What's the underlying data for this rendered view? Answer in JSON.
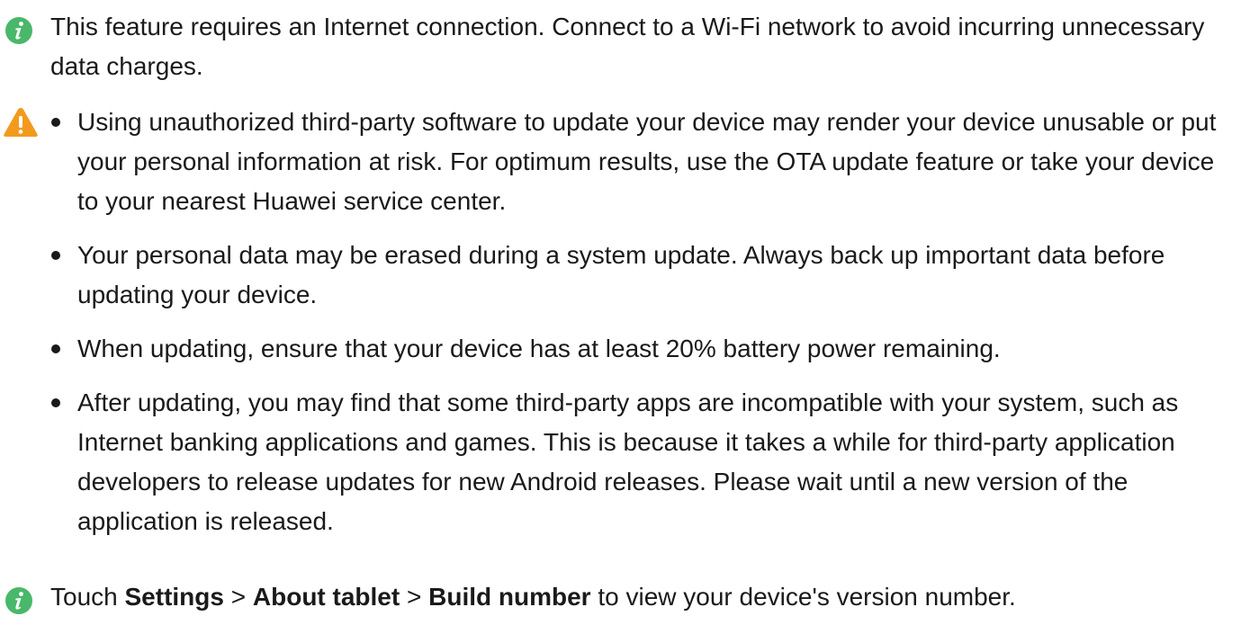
{
  "notes": {
    "internet_note": "This feature requires an Internet connection. Connect to a Wi-Fi network to avoid incurring unnecessary data charges.",
    "warnings": [
      "Using unauthorized third-party software to update your device may render your device unusable or put your personal information at risk. For optimum results, use the OTA update feature or take your device to your nearest Huawei service center.",
      "Your personal data may be erased during a system update. Always back up important data before updating your device.",
      "When updating, ensure that your device has at least 20% battery power remaining.",
      "After updating, you may find that some third-party apps are incompatible with your system, such as Internet banking applications and games. This is because it takes a while for third-party application developers to release updates for new Android releases. Please wait until a new version of the application is released."
    ],
    "version_note": {
      "prefix": "Touch ",
      "settings": "Settings",
      "sep1": " > ",
      "about": "About tablet",
      "sep2": " > ",
      "build": "Build number",
      "suffix": " to view your device's version number."
    }
  },
  "colors": {
    "info_icon": "#49b86a",
    "warning_icon": "#f39a1e",
    "text": "#1a1a1a"
  },
  "icons": {
    "info": "info-icon",
    "warning": "warning-icon"
  }
}
